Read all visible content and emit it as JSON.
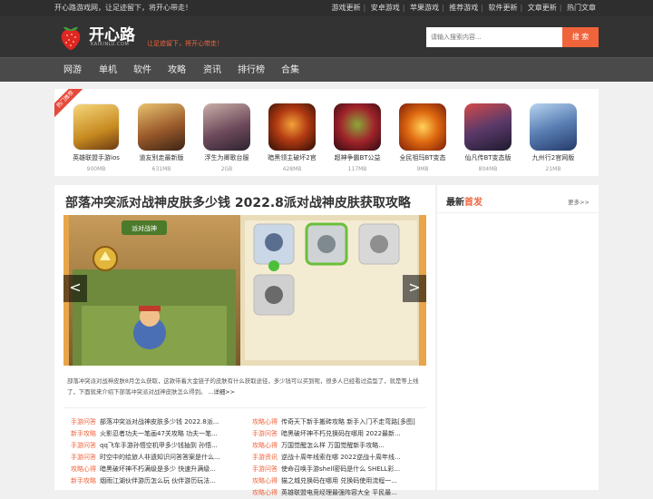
{
  "topbar": {
    "tagline": "开心路游戏网，让足迹留下，将开心带走！",
    "links": [
      "游戏更新",
      "安卓游戏",
      "苹果游戏",
      "推荐游戏",
      "软件更新",
      "文章更新",
      "热门文章"
    ]
  },
  "header": {
    "site_name": "开心路",
    "site_url": "KAIXINLU.COM",
    "slogan": "让足迹留下，将开心带走！",
    "search_placeholder": "请输入搜索内容...",
    "search_button": "搜 索"
  },
  "nav": [
    "网游",
    "单机",
    "软件",
    "攻略",
    "资讯",
    "排行榜",
    "合集"
  ],
  "hot_badge": "热门推荐",
  "games": [
    {
      "name": "英雄联盟手游ios",
      "size": "900MB"
    },
    {
      "name": "道友别走最新版",
      "size": "631MB"
    },
    {
      "name": "浮生为卿歌台服",
      "size": "2GB"
    },
    {
      "name": "暗黑领主破坏2官",
      "size": "428MB"
    },
    {
      "name": "超神争霸BT公益",
      "size": "117MB"
    },
    {
      "name": "全民祖玛BT变态",
      "size": "9MB"
    },
    {
      "name": "仙凡传BT变态版",
      "size": "804MB"
    },
    {
      "name": "九州行2官网版",
      "size": "21MB"
    }
  ],
  "article": {
    "title": "部落冲突派对战神皮肤多少钱 2022.8派对战神皮肤获取攻略",
    "banner_caption": "派对战神",
    "prev_arrow": "<",
    "next_arrow": ">",
    "summary": "部落冲突派对战神皮肤8月怎么获取，这款带着大金链子的皮肤有什么获取途径，多少钱可以买到呢，很多人已经看过造型了，就是等上线了，下面就来介绍下部落冲突派对战神皮肤怎么得到。",
    "more": "...详细>>"
  },
  "left_list": [
    {
      "cat": "手游问答",
      "title": "部落冲突派对战神皮肤多少钱 2022.8派..."
    },
    {
      "cat": "新手攻略",
      "title": "火影忍者功夫一笔画47关攻略 功夫一笔..."
    },
    {
      "cat": "手游问答",
      "title": "qq飞车手游孙悟空机甲多少钱抽到 孙悟..."
    },
    {
      "cat": "手游问答",
      "title": "时空中的绘旅人非遗知识问答答案是什么..."
    },
    {
      "cat": "攻略心得",
      "title": "暗黑破坏神不朽满级是多少 快速升满级..."
    },
    {
      "cat": "新手攻略",
      "title": "烟雨江湖伙伴游历怎么玩 伙伴游历玩法..."
    }
  ],
  "right_list": [
    {
      "cat": "攻略心得",
      "title": "传奇天下新手搬砖攻略 新手入门不走弯路[多图]"
    },
    {
      "cat": "手游问答",
      "title": "暗黑破坏神不朽兑换码在哪用 2022最新..."
    },
    {
      "cat": "攻略心得",
      "title": "万国觉醒怎么样 万国觉醒新手攻略..."
    },
    {
      "cat": "手游资讯",
      "title": "逆战十周年线索在哪 2022逆战十周年线..."
    },
    {
      "cat": "手游问答",
      "title": "使命召唤手游shell密码是什么 SHELL彩..."
    },
    {
      "cat": "攻略心得",
      "title": "猫之城兑换码在哪用 兑换码使用流程一..."
    },
    {
      "cat": "攻略心得",
      "title": "英雄联盟电竞经理最强阵容大全 平民最..."
    }
  ],
  "sidebar": {
    "title_prefix": "最新",
    "title_highlight": "首发",
    "more": "更多>>"
  },
  "colors": {
    "accent": "#f0643c",
    "topbar": "#2e2e2e",
    "header": "#333333",
    "nav": "#4a4a4a"
  }
}
